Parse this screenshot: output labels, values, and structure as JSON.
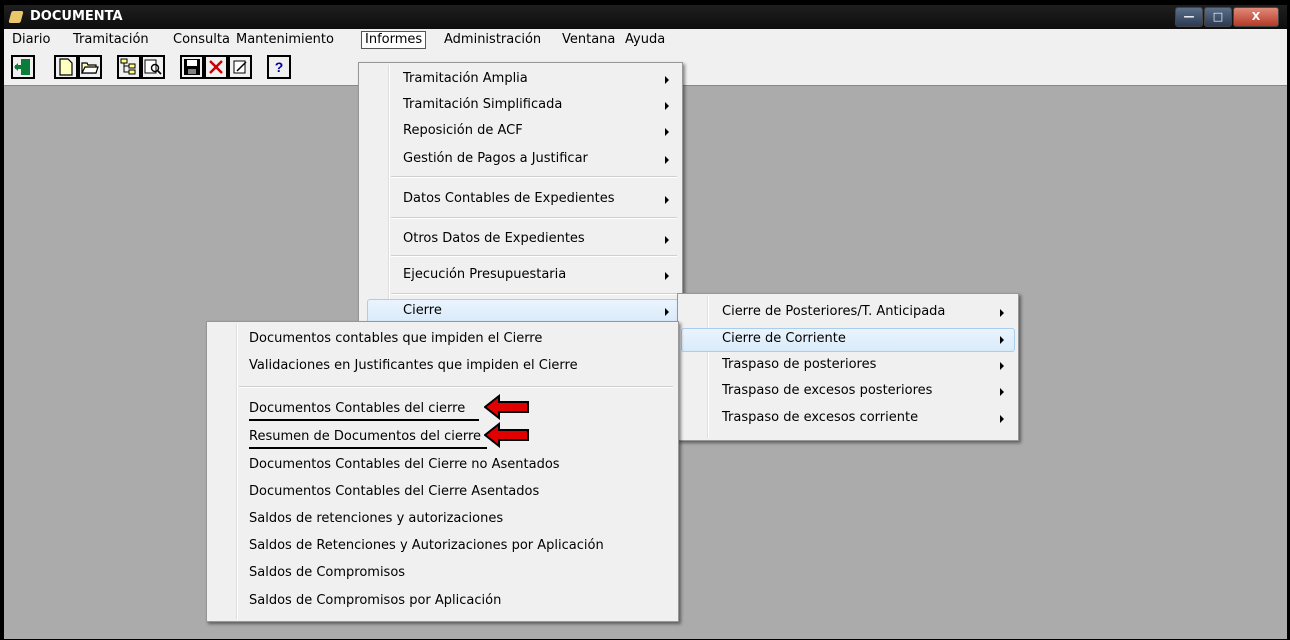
{
  "window": {
    "title": "DOCUMENTA",
    "controls": {
      "minimize": "—",
      "maximize": "□",
      "close": "X"
    }
  },
  "menubar": {
    "items": [
      "Diario",
      "Tramitación",
      "Consulta",
      "Mantenimiento",
      "Informes",
      "Administración",
      "Ventana",
      "Ayuda"
    ],
    "active": "Informes"
  },
  "toolbar": {
    "buttons": [
      {
        "icon": "exit-door-icon"
      },
      {
        "icon": "new-document-icon"
      },
      {
        "icon": "open-folder-icon"
      },
      {
        "icon": "tree-view-icon"
      },
      {
        "icon": "preview-search-icon"
      },
      {
        "icon": "save-disk-icon"
      },
      {
        "icon": "delete-x-icon"
      },
      {
        "icon": "edit-icon"
      },
      {
        "icon": "help-icon",
        "glyph": "?"
      }
    ]
  },
  "informes_menu": {
    "items": [
      {
        "label": "Tramitación Amplia",
        "submenu": true
      },
      {
        "label": "Tramitación Simplificada",
        "submenu": true
      },
      {
        "label": "Reposición de ACF",
        "submenu": true
      },
      {
        "label": "Gestión  de Pagos a Justificar",
        "submenu": true
      },
      {
        "label": "Datos Contables de Expedientes",
        "submenu": true
      },
      {
        "label": "Otros Datos de Expedientes",
        "submenu": true
      },
      {
        "label": "Ejecución Presupuestaria",
        "submenu": true
      },
      {
        "label": "Cierre",
        "submenu": true,
        "highlighted": true
      }
    ]
  },
  "cierre_menu": {
    "items": [
      {
        "label": "Cierre de Posteriores/T. Anticipada",
        "submenu": true
      },
      {
        "label": "Cierre de Corriente",
        "submenu": true,
        "highlighted": true
      },
      {
        "label": "Traspaso de posteriores",
        "submenu": true
      },
      {
        "label": "Traspaso de excesos  posteriores",
        "submenu": true
      },
      {
        "label": "Traspaso de excesos  corriente",
        "submenu": true
      }
    ]
  },
  "corriente_menu": {
    "items": [
      {
        "label": "Documentos contables que impiden el Cierre"
      },
      {
        "label": "Validaciones en Justificantes que impiden el Cierre"
      },
      {
        "label": "Documentos Contables del cierre",
        "marked": true
      },
      {
        "label": "Resumen de Documentos del cierre",
        "marked": true
      },
      {
        "label": "Documentos Contables del Cierre  no Asentados"
      },
      {
        "label": "Documentos Contables del Cierre Asentados"
      },
      {
        "label": "Saldos de retenciones y autorizaciones"
      },
      {
        "label": "Saldos de Retenciones y Autorizaciones por Aplicación"
      },
      {
        "label": "Saldos de Compromisos"
      },
      {
        "label": "Saldos de Compromisos por Aplicación"
      }
    ]
  },
  "colors": {
    "workspace": "#ababab",
    "highlight": "#d9ebfa",
    "annotation_arrow": "#e00000"
  }
}
